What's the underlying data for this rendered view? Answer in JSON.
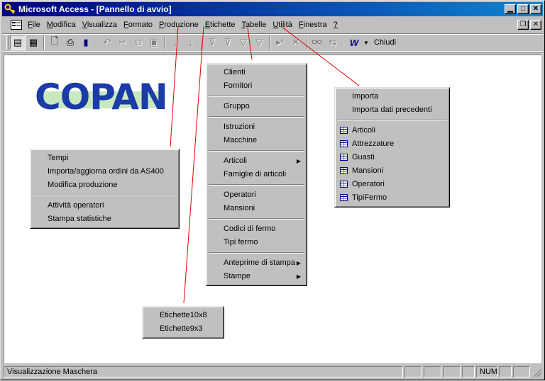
{
  "titlebar": {
    "title": "Microsoft Access - [Pannello di avvio]"
  },
  "menubar": {
    "items": [
      {
        "label": "File",
        "ul": "F",
        "rest": "ile"
      },
      {
        "label": "Modifica",
        "ul": "M",
        "rest": "odifica"
      },
      {
        "label": "Visualizza",
        "ul": "V",
        "rest": "isualizza"
      },
      {
        "label": "Formato",
        "ul": "F",
        "rest": "ormato"
      },
      {
        "label": "Produzione",
        "ul": "P",
        "rest": "roduzione"
      },
      {
        "label": "Etichette",
        "ul": "E",
        "rest": "tichette"
      },
      {
        "label": "Tabelle",
        "ul": "T",
        "rest": "abelle"
      },
      {
        "label": "Utilità",
        "ul": "U",
        "rest": "tilità"
      },
      {
        "label": "Finestra",
        "ul": "F",
        "rest": "inestra"
      },
      {
        "label": "?",
        "ul": "?",
        "rest": ""
      }
    ]
  },
  "toolbar": {
    "close_label": "Chiudi",
    "icons": [
      "form-view-icon",
      "datasheet-view-icon",
      "print-preview-icon",
      "print-icon",
      "spelling-icon",
      "undo-icon",
      "cut-icon",
      "copy-icon",
      "paste-icon",
      "sort-ascending-icon",
      "sort-descending-icon",
      "filter-by-selection-icon",
      "filter-by-form-icon",
      "apply-filter-icon",
      "new-record-icon",
      "delete-record-icon",
      "find-icon",
      "database-window-icon",
      "office-links-icon"
    ]
  },
  "logo": {
    "text": "COPAN"
  },
  "menus": {
    "produzione": {
      "items": [
        "Tempi",
        "Importa/aggiorna ordini da AS400",
        "Modifica produzione",
        "Attività operatori",
        "Stampa statistiche"
      ]
    },
    "tabelle": {
      "items": [
        "Clienti",
        "Fornitori",
        "Gruppo",
        "Istruzioni",
        "Macchine",
        "Articoli",
        "Famiglie di articoli",
        "Operatori",
        "Mansioni",
        "Codici di fermo",
        "Tipi fermo",
        "Anteprime di stampa",
        "Stampe"
      ]
    },
    "utilita": {
      "items": [
        "Importa",
        "Importa dati precedenti",
        "Articoli",
        "Attrezzature",
        "Guasti",
        "Mansioni",
        "Operatori",
        "TipiFermo"
      ]
    },
    "etichette": {
      "items": [
        "Etichette10x8",
        "Etichette9x3"
      ]
    }
  },
  "statusbar": {
    "text": "Visualizzazione Maschera",
    "num": "NUM"
  },
  "colors": {
    "title_start": "#000080",
    "title_end": "#1084d0",
    "annotation_line": "#e00000",
    "logo": "#1a3ba8"
  }
}
